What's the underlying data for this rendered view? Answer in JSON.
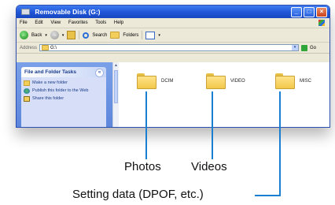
{
  "window": {
    "title": "Removable Disk (G:)",
    "controls": [
      "_",
      "□",
      "×"
    ]
  },
  "menu": [
    "File",
    "Edit",
    "View",
    "Favorites",
    "Tools",
    "Help"
  ],
  "toolbar": {
    "back_label": "Back",
    "search_label": "Search",
    "folders_label": "Folders"
  },
  "address": {
    "label": "Address",
    "value": "G:\\",
    "go_label": "Go"
  },
  "tasks": {
    "header": "File and Folder Tasks",
    "collapse_glyph": "«",
    "items": [
      "Make a new folder",
      "Publish this folder to the Web",
      "Share this folder"
    ]
  },
  "folders": [
    {
      "name": "DCIM"
    },
    {
      "name": "VIDEO"
    },
    {
      "name": "MISC"
    }
  ],
  "callouts": {
    "photos": "Photos",
    "videos": "Videos",
    "setting": "Setting data (DPOF, etc.)"
  },
  "colors": {
    "title_bar": "#1f55d6",
    "callout_line": "#1a7fd0",
    "task_pane": "#6b92e0"
  }
}
